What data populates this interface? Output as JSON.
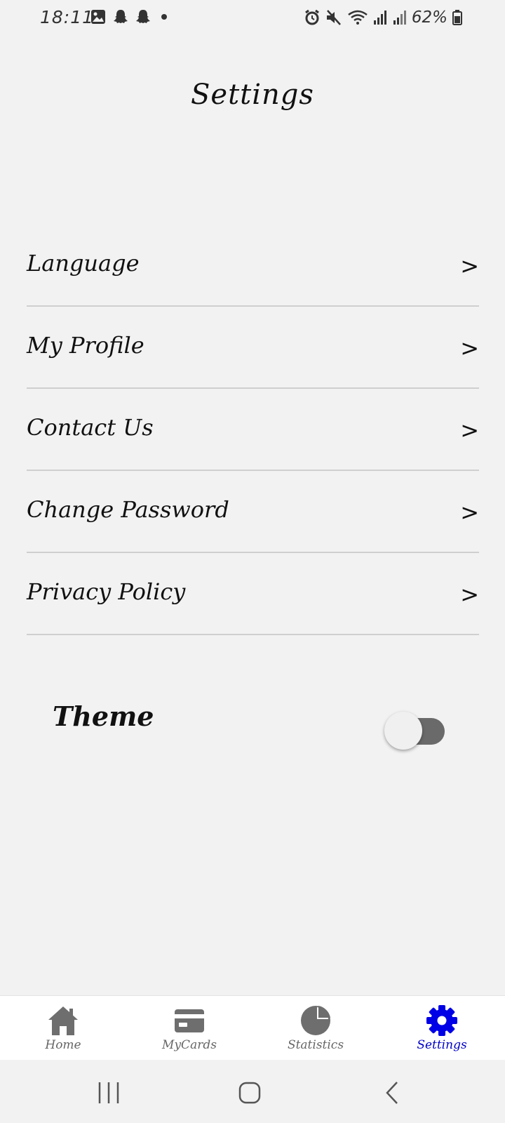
{
  "status_bar": {
    "time": "18:11",
    "battery": "62%",
    "left_icons": [
      "gallery-icon",
      "snapchat-icon",
      "snapchat-icon",
      "dot-icon"
    ],
    "right_icons": [
      "alarm-icon",
      "mute-icon",
      "wifi-icon",
      "signal-icon",
      "signal-icon",
      "battery-icon"
    ]
  },
  "page": {
    "title": "Settings"
  },
  "settings": {
    "items": [
      {
        "label": "Language",
        "chevron": ">"
      },
      {
        "label": "My Profile",
        "chevron": ">"
      },
      {
        "label": "Contact Us",
        "chevron": ">"
      },
      {
        "label": "Change Password",
        "chevron": ">"
      },
      {
        "label": "Privacy Policy",
        "chevron": ">"
      }
    ]
  },
  "theme": {
    "label": "Theme",
    "enabled": false
  },
  "bottom_nav": {
    "items": [
      {
        "label": "Home",
        "icon": "home-icon",
        "active": false
      },
      {
        "label": "MyCards",
        "icon": "card-icon",
        "active": false
      },
      {
        "label": "Statistics",
        "icon": "pie-chart-icon",
        "active": false
      },
      {
        "label": "Settings",
        "icon": "gear-icon",
        "active": true
      }
    ]
  },
  "colors": {
    "background": "#f2f2f2",
    "active_nav": "#0000c8",
    "inactive_nav": "#666666",
    "divider": "#cfcfcf",
    "toggle_track": "#6a6a6a"
  }
}
